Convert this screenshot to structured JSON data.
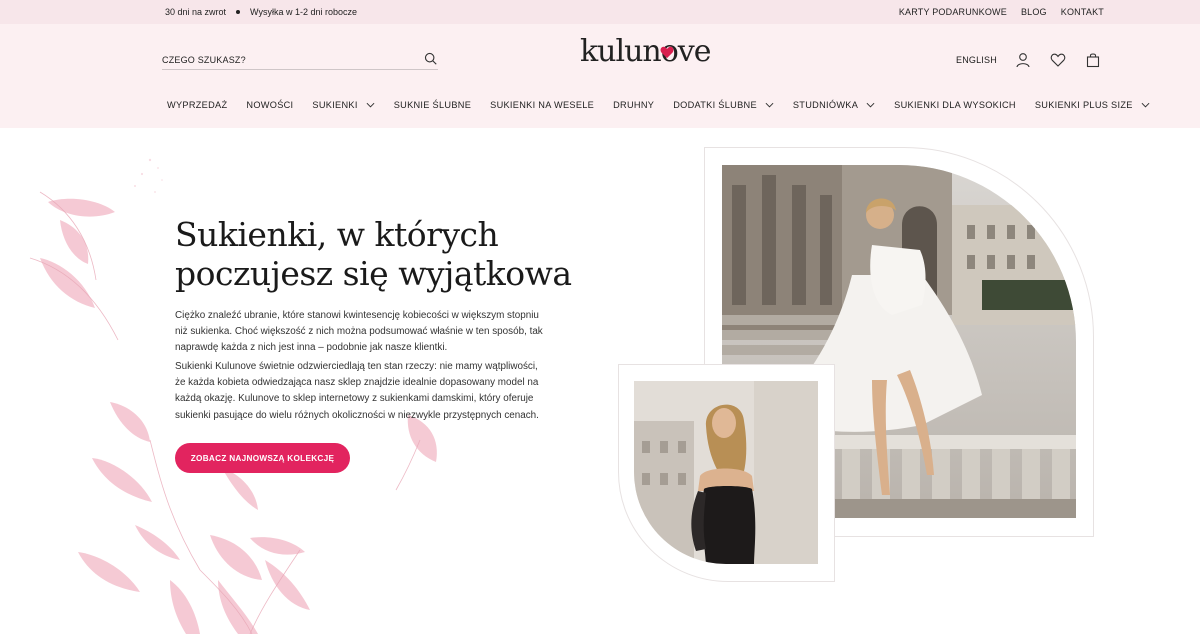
{
  "topbar": {
    "left_items": [
      "30 dni na zwrot",
      "Wysyłka w 1-2 dni robocze"
    ],
    "right_links": [
      "KARTY PODARUNKOWE",
      "BLOG",
      "KONTAKT"
    ]
  },
  "header": {
    "search_placeholder": "CZEGO SZUKASZ?",
    "logo_text": "kulunove",
    "language": "ENGLISH",
    "icons": [
      "search-icon",
      "user-icon",
      "heart-icon",
      "bag-icon"
    ]
  },
  "nav": {
    "items": [
      {
        "label": "WYPRZEDAŻ",
        "dropdown": false
      },
      {
        "label": "NOWOŚCI",
        "dropdown": false
      },
      {
        "label": "SUKIENKI",
        "dropdown": true
      },
      {
        "label": "SUKNIE ŚLUBNE",
        "dropdown": false
      },
      {
        "label": "SUKIENKI NA WESELE",
        "dropdown": false
      },
      {
        "label": "DRUHNY",
        "dropdown": false
      },
      {
        "label": "DODATKI ŚLUBNE",
        "dropdown": true
      },
      {
        "label": "STUDNIÓWKA",
        "dropdown": true
      },
      {
        "label": "SUKIENKI DLA WYSOKICH",
        "dropdown": false
      },
      {
        "label": "SUKIENKI PLUS SIZE",
        "dropdown": true
      }
    ]
  },
  "hero": {
    "title_line1": "Sukienki, w których",
    "title_line2": "poczujesz się wyjątkowa",
    "paragraph1_lines": [
      "Ciężko znaleźć ubranie, które stanowi kwintesencję kobiecości w większym stopniu",
      "niż sukienka. Choć większość z nich można podsumować właśnie w ten sposób, tak",
      "naprawdę każda z nich jest inna – podobnie jak nasze klientki."
    ],
    "paragraph2_lines": [
      "Sukienki Kulunove świetnie odzwierciedlają ten stan rzeczy: nie mamy wątpliwości,",
      "że każda kobieta odwiedzająca nasz sklep znajdzie idealnie dopasowany model na",
      "każdą okazję. Kulunove to sklep internetowy z sukienkami damskimi, który oferuje",
      "sukienki pasujące do wielu różnych okoliczności w niezwykle przystępnych cenach."
    ],
    "cta_label": "ZOBACZ NAJNOWSZĄ KOLEKCJĘ"
  },
  "colors": {
    "accent": "#e2245f",
    "topbar_bg": "#f7e6ea",
    "header_bg": "#fcf0f2",
    "leaf_pink": "#f2b8c6"
  }
}
